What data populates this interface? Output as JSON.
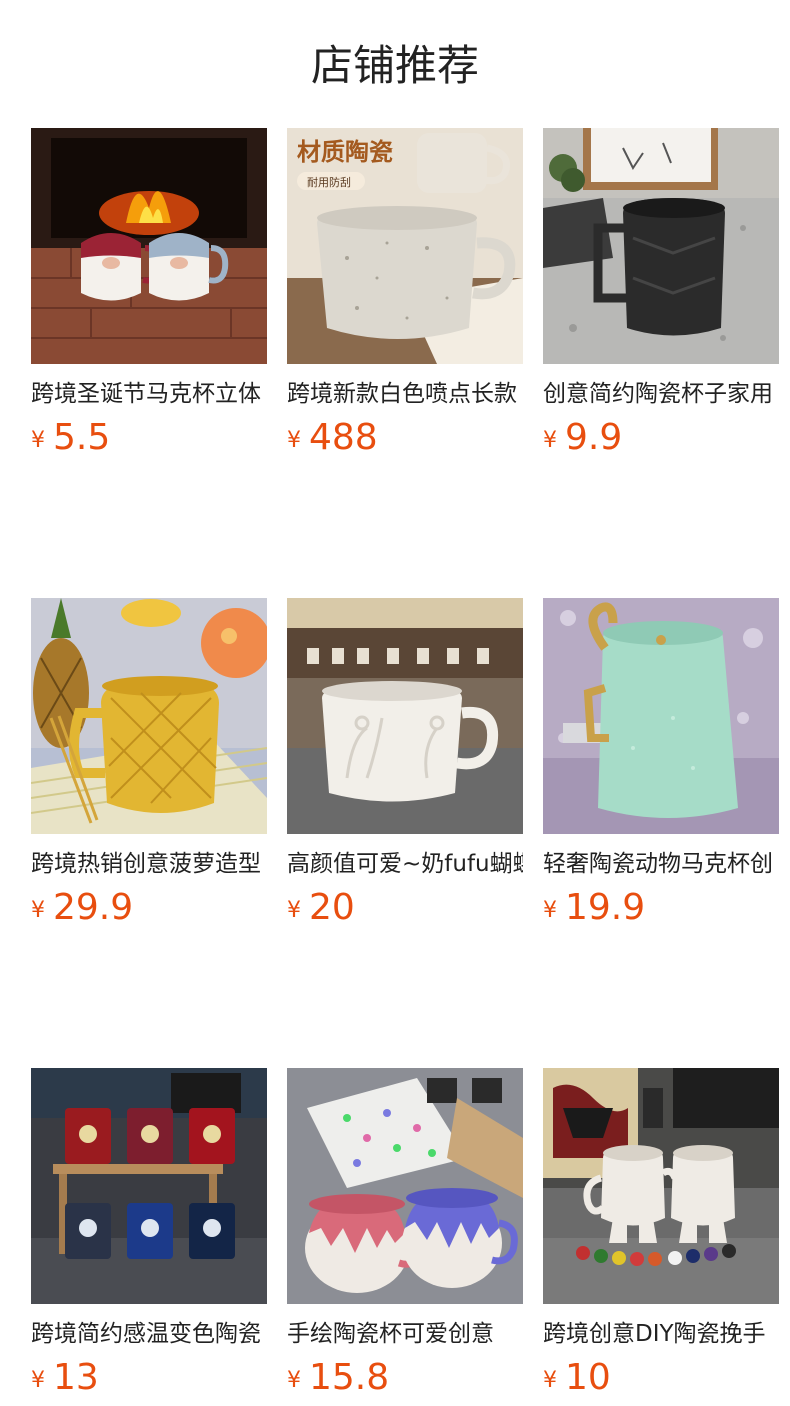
{
  "header": {
    "title": "店铺推荐"
  },
  "currency": "¥",
  "products": [
    {
      "name": "跨境圣诞节马克杯立体",
      "price": "5.5",
      "image_icon": "christmas-mugs-fireplace-image"
    },
    {
      "name": "跨境新款白色喷点长款",
      "price": "488",
      "image_icon": "speckled-white-mug-image",
      "overlay_title": "材质陶瓷",
      "overlay_badge": "耐用防刮"
    },
    {
      "name": "创意简约陶瓷杯子家用",
      "price": "9.9",
      "image_icon": "black-faceted-mug-image"
    },
    {
      "name": "跨境热销创意菠萝造型",
      "price": "29.9",
      "image_icon": "pineapple-mug-image"
    },
    {
      "name": "高颜值可爱~奶fufu蝴蝶",
      "price": "20",
      "image_icon": "white-embossed-mug-image"
    },
    {
      "name": "轻奢陶瓷动物马克杯创",
      "price": "19.9",
      "image_icon": "mint-gold-mug-image"
    },
    {
      "name": "跨境简约感温变色陶瓷",
      "price": "13",
      "image_icon": "football-club-mugs-image"
    },
    {
      "name": "手绘陶瓷杯可爱创意",
      "price": "15.8",
      "image_icon": "drip-painted-mugs-image"
    },
    {
      "name": "跨境创意DIY陶瓷挽手",
      "price": "10",
      "image_icon": "diy-figure-mugs-image"
    }
  ]
}
